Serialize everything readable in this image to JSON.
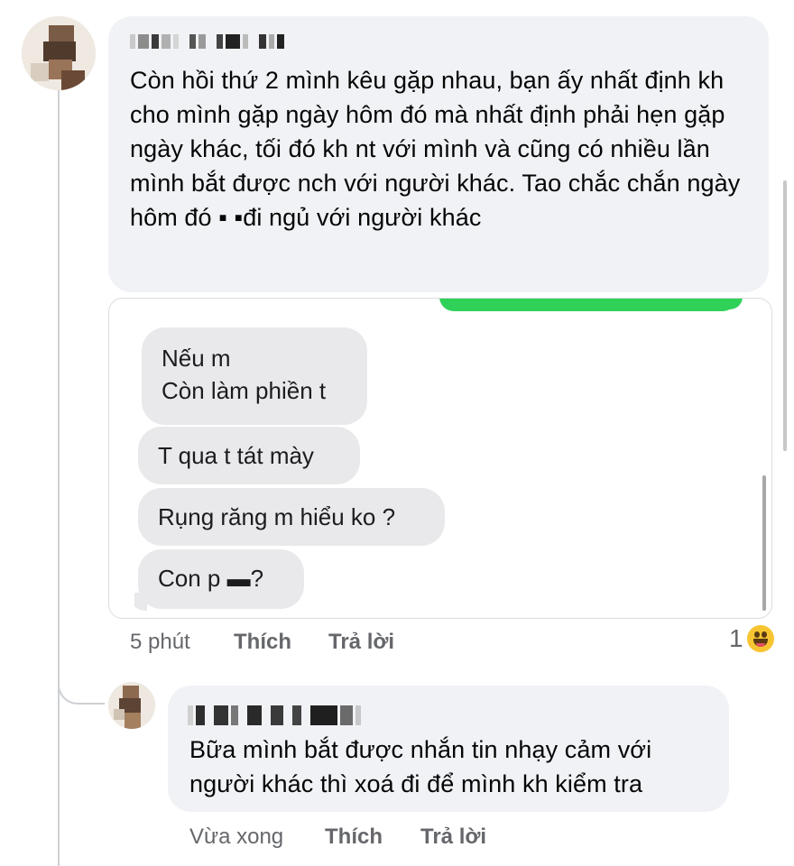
{
  "comment1": {
    "author_name": "",
    "text": "Còn hồi thứ 2 mình kêu gặp nhau, bạn ấy nhất định kh cho mình gặp ngày hôm đó mà nhất định phải hẹn gặp ngày khác, tối đó kh nt với mình và cũng có nhiều lần mình bắt được nch với người khác. Tao chắc chắn ngày hôm đó ▪ ▪đi ngủ với người khác",
    "time": "5 phút",
    "like": "Thích",
    "reply": "Trả lời",
    "reaction_count": "1",
    "reaction_icon": "laughing-emoji"
  },
  "screenshot": {
    "messages": [
      {
        "line1": "Nếu m",
        "line2": "Còn làm phiền t"
      },
      {
        "line1": "T qua t tát mày"
      },
      {
        "line1": "Rụng răng m hiểu ko ?"
      },
      {
        "line1": "Con p ▬?"
      }
    ],
    "colors": {
      "outgoing": "#30d158",
      "incoming": "#e9e9eb"
    }
  },
  "reply1": {
    "author_name": "",
    "text": "Bữa mình bắt được nhắn tin nhạy cảm với người khác thì xoá đi để mình kh kiểm tra",
    "time": "Vừa xong",
    "like": "Thích",
    "reply": "Trả lời"
  }
}
